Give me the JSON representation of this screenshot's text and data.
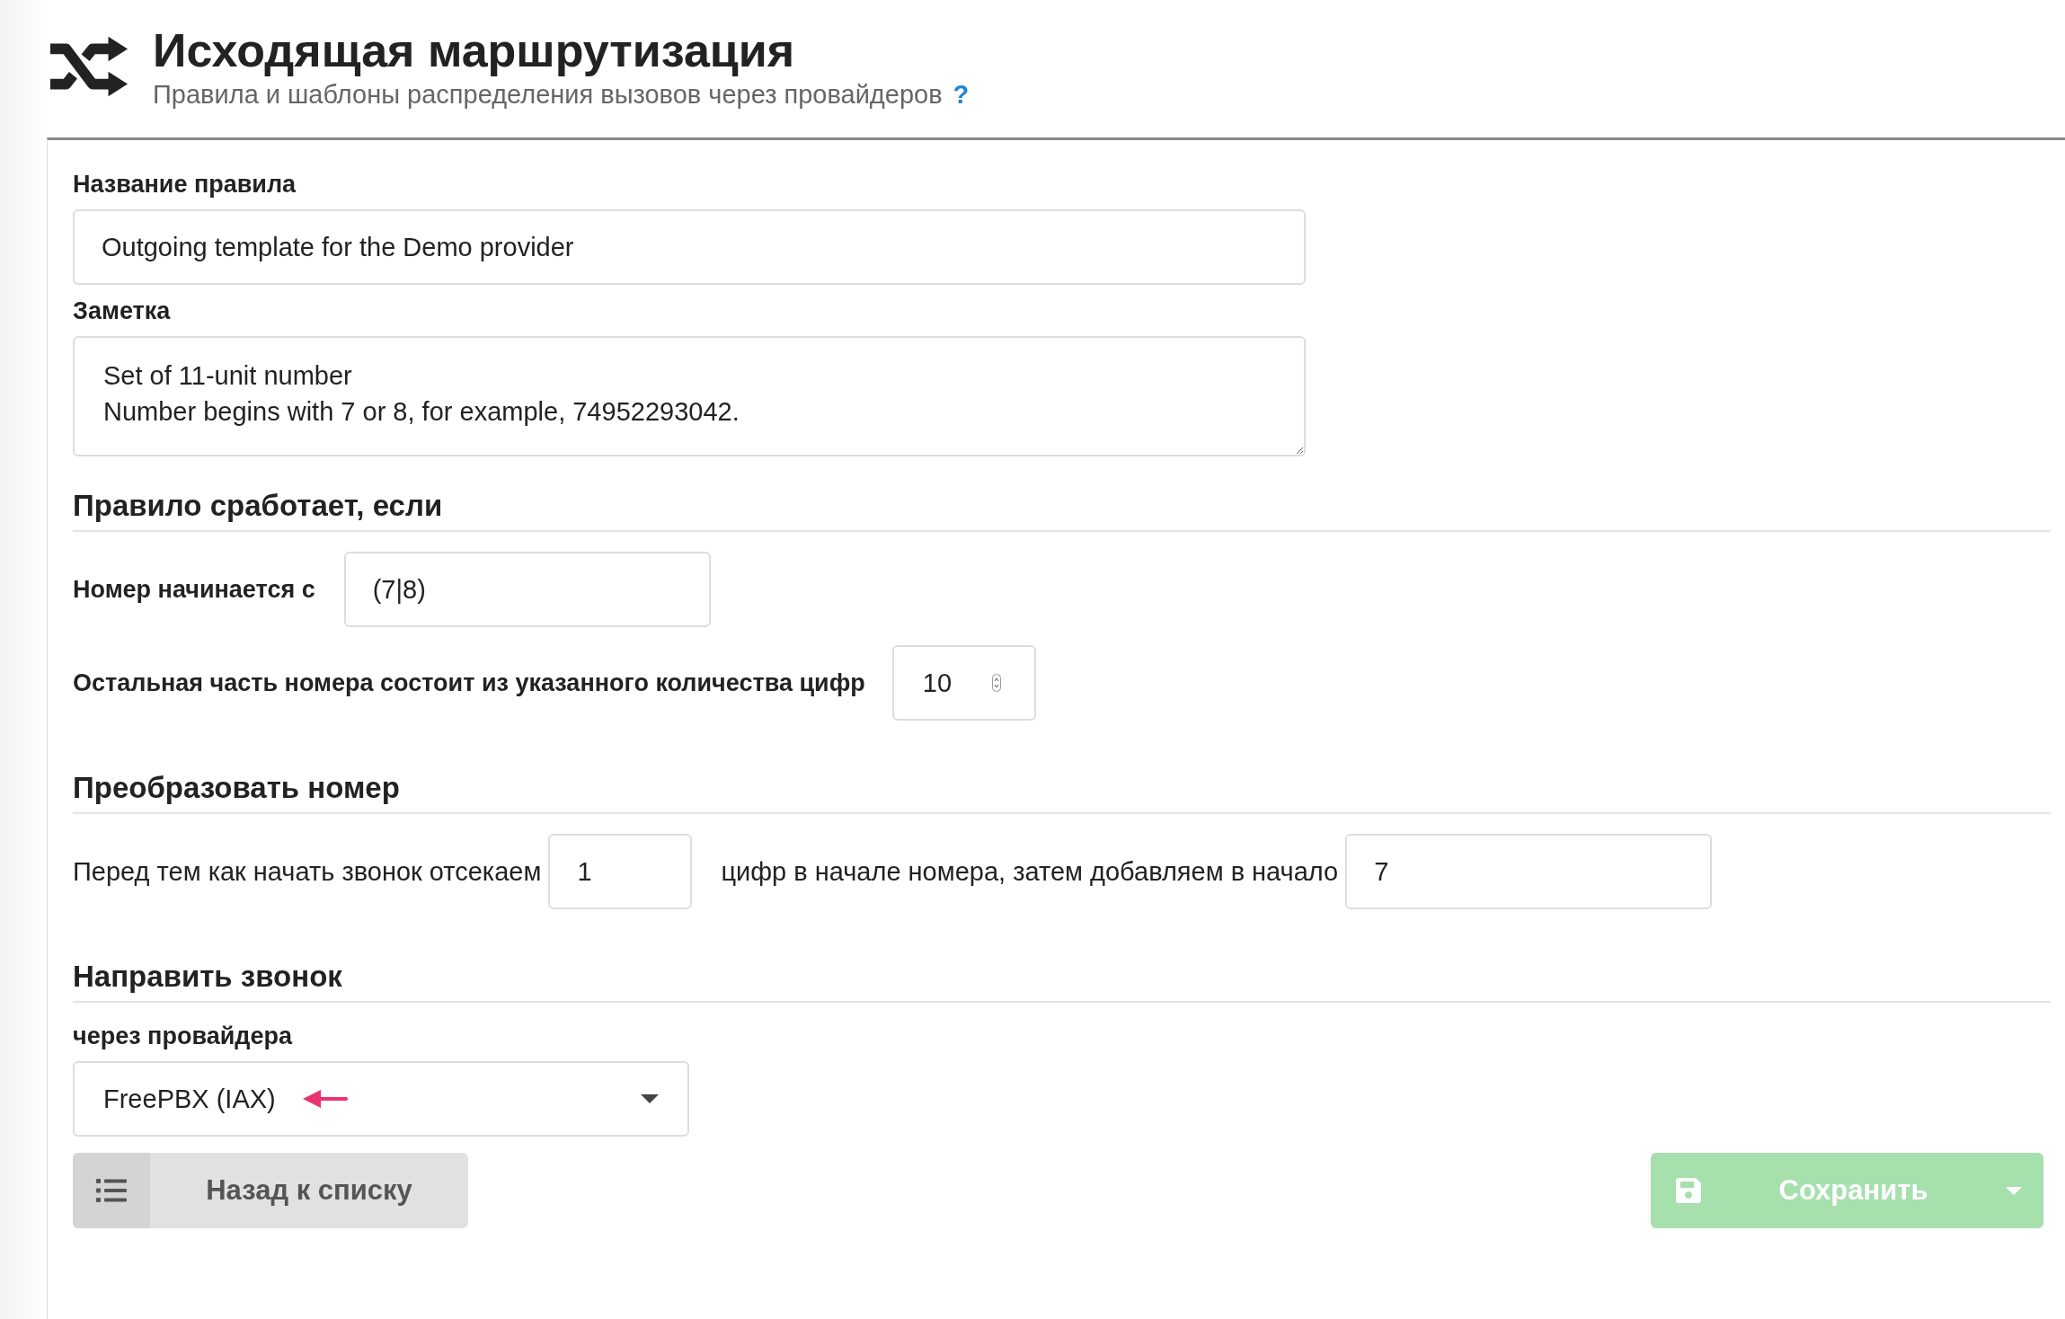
{
  "header": {
    "title": "Исходящая маршрутизация",
    "subtitle": "Правила и шаблоны распределения вызовов через провайдеров",
    "help": "?"
  },
  "form": {
    "name": {
      "label": "Название правила",
      "value": "Outgoing template for the Demo provider"
    },
    "note": {
      "label": "Заметка",
      "value": "Set of 11-unit number\nNumber begins with 7 or 8, for example, 74952293042."
    },
    "sections": [
      {
        "title": "Правило сработает, если",
        "rows": [
          {
            "kind": "label-field",
            "label": "Номер начинается с",
            "value": "(7|8)"
          },
          {
            "kind": "label-number",
            "label": "Остальная часть номера состоит из указанного количества цифр",
            "value": "10"
          }
        ]
      },
      {
        "title": "Преобразовать номер",
        "rows": [
          {
            "kind": "sentence",
            "parts": [
              {
                "text": "Перед тем как начать звонок отсекаем",
                "value": "1"
              },
              {
                "text": "цифр в начале номера, затем добавляем в начало",
                "value": "7"
              }
            ]
          }
        ]
      },
      {
        "title": "Направить звонок",
        "rows": [
          {
            "kind": "select",
            "label": "через провайдера",
            "value": "FreePBX (IAX)"
          }
        ]
      }
    ]
  },
  "buttons": {
    "back": {
      "label": "Назад к списку"
    },
    "save": {
      "label": "Сохранить",
      "disabled": true
    }
  }
}
